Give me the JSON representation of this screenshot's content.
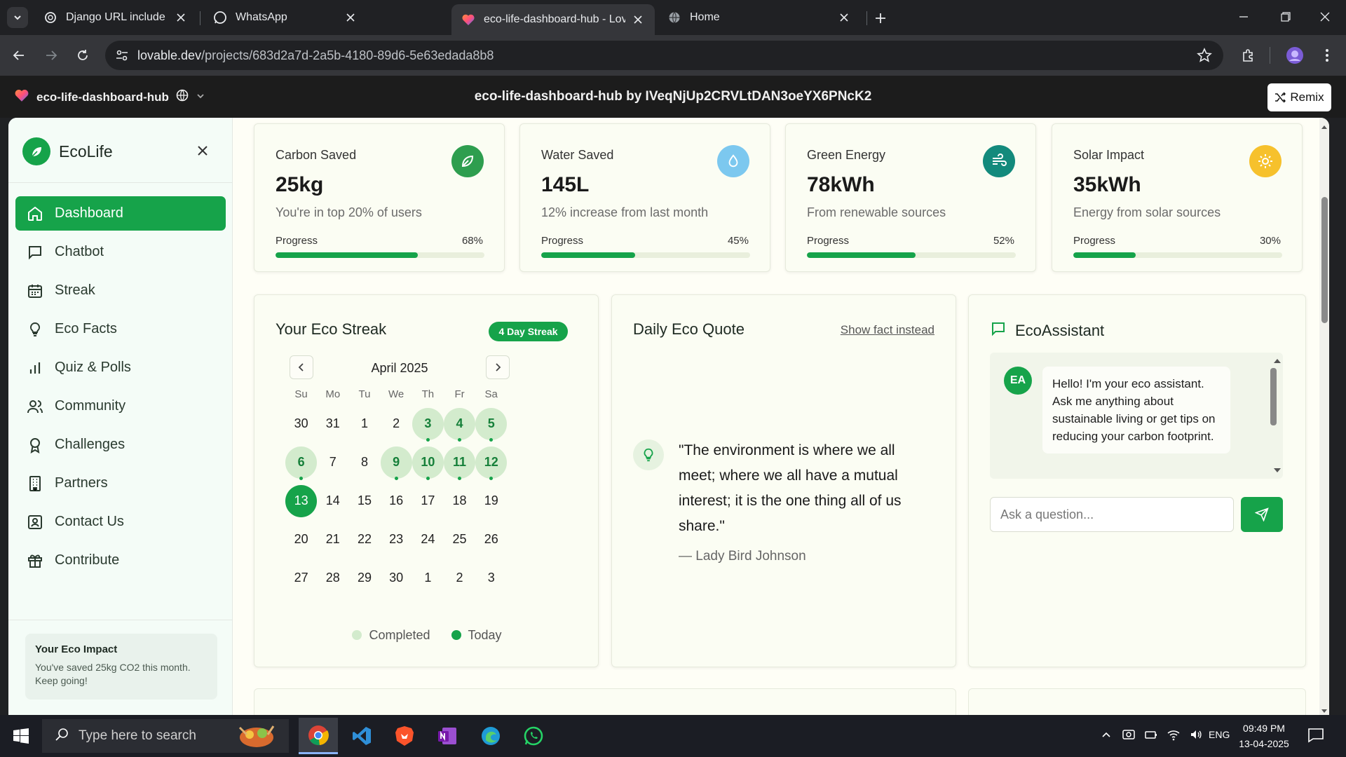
{
  "browser": {
    "tabs": [
      {
        "title": "Django URL include warning",
        "active": false
      },
      {
        "title": "WhatsApp",
        "active": false
      },
      {
        "title": "eco-life-dashboard-hub - Lovab",
        "active": true
      },
      {
        "title": "Home",
        "active": false
      }
    ],
    "url_domain": "lovable.dev",
    "url_path": "/projects/683d2a7d-2a5b-4180-89d6-5e63edada8b8"
  },
  "lovable": {
    "project_name": "eco-life-dashboard-hub",
    "header_title": "eco-life-dashboard-hub by IVeqNjUp2CRVLtDAN3oeYX6PNcK2",
    "remix_label": "Remix"
  },
  "sidebar": {
    "brand": "EcoLife",
    "items": [
      {
        "label": "Dashboard",
        "icon": "home-icon",
        "active": true
      },
      {
        "label": "Chatbot",
        "icon": "chat-icon",
        "active": false
      },
      {
        "label": "Streak",
        "icon": "calendar-icon",
        "active": false
      },
      {
        "label": "Eco Facts",
        "icon": "lightbulb-icon",
        "active": false
      },
      {
        "label": "Quiz & Polls",
        "icon": "bar-chart-icon",
        "active": false
      },
      {
        "label": "Community",
        "icon": "users-icon",
        "active": false
      },
      {
        "label": "Challenges",
        "icon": "award-icon",
        "active": false
      },
      {
        "label": "Partners",
        "icon": "building-icon",
        "active": false
      },
      {
        "label": "Contact Us",
        "icon": "contact-icon",
        "active": false
      },
      {
        "label": "Contribute",
        "icon": "gift-icon",
        "active": false
      }
    ],
    "impact_title": "Your Eco Impact",
    "impact_text": "You've saved 25kg CO2 this month. Keep going!"
  },
  "stats": [
    {
      "label": "Carbon Saved",
      "value": "25kg",
      "sub": "You're in top 20% of users",
      "progress_label": "Progress",
      "percent_text": "68%",
      "percent": 68,
      "icon": "leaf-icon",
      "color": "#2e9e4f"
    },
    {
      "label": "Water Saved",
      "value": "145L",
      "sub": "12% increase from last month",
      "progress_label": "Progress",
      "percent_text": "45%",
      "percent": 45,
      "icon": "droplet-icon",
      "color": "#7cc8ef"
    },
    {
      "label": "Green Energy",
      "value": "78kWh",
      "sub": "From renewable sources",
      "progress_label": "Progress",
      "percent_text": "52%",
      "percent": 52,
      "icon": "wind-icon",
      "color": "#138a7c"
    },
    {
      "label": "Solar Impact",
      "value": "35kWh",
      "sub": "Energy from solar sources",
      "progress_label": "Progress",
      "percent_text": "30%",
      "percent": 30,
      "icon": "sun-icon",
      "color": "#f6c12c"
    }
  ],
  "streak": {
    "title": "Your Eco Streak",
    "badge": "4 Day Streak",
    "month": "April 2025",
    "weekdays": [
      "Su",
      "Mo",
      "Tu",
      "We",
      "Th",
      "Fr",
      "Sa"
    ],
    "weeks": [
      [
        {
          "d": "30",
          "s": ""
        },
        {
          "d": "31",
          "s": ""
        },
        {
          "d": "1",
          "s": ""
        },
        {
          "d": "2",
          "s": ""
        },
        {
          "d": "3",
          "s": "done"
        },
        {
          "d": "4",
          "s": "done"
        },
        {
          "d": "5",
          "s": "done"
        }
      ],
      [
        {
          "d": "6",
          "s": "done"
        },
        {
          "d": "7",
          "s": ""
        },
        {
          "d": "8",
          "s": ""
        },
        {
          "d": "9",
          "s": "done"
        },
        {
          "d": "10",
          "s": "done"
        },
        {
          "d": "11",
          "s": "done"
        },
        {
          "d": "12",
          "s": "done"
        }
      ],
      [
        {
          "d": "13",
          "s": "today"
        },
        {
          "d": "14",
          "s": ""
        },
        {
          "d": "15",
          "s": ""
        },
        {
          "d": "16",
          "s": ""
        },
        {
          "d": "17",
          "s": ""
        },
        {
          "d": "18",
          "s": ""
        },
        {
          "d": "19",
          "s": ""
        }
      ],
      [
        {
          "d": "20",
          "s": ""
        },
        {
          "d": "21",
          "s": ""
        },
        {
          "d": "22",
          "s": ""
        },
        {
          "d": "23",
          "s": ""
        },
        {
          "d": "24",
          "s": ""
        },
        {
          "d": "25",
          "s": ""
        },
        {
          "d": "26",
          "s": ""
        }
      ],
      [
        {
          "d": "27",
          "s": ""
        },
        {
          "d": "28",
          "s": ""
        },
        {
          "d": "29",
          "s": ""
        },
        {
          "d": "30",
          "s": ""
        },
        {
          "d": "1",
          "s": ""
        },
        {
          "d": "2",
          "s": ""
        },
        {
          "d": "3",
          "s": ""
        }
      ]
    ],
    "legend_completed": "Completed",
    "legend_today": "Today"
  },
  "quote": {
    "title": "Daily Eco Quote",
    "toggle": "Show fact instead",
    "text": "\"The environment is where we all meet; where we all have a mutual interest; it is the one thing all of us share.\"",
    "author": "— Lady Bird Johnson"
  },
  "assistant": {
    "title": "EcoAssistant",
    "avatar": "EA",
    "message": "Hello! I'm your eco assistant. Ask me anything about sustainable living or get tips on reducing your carbon footprint.",
    "placeholder": "Ask a question..."
  },
  "taskbar": {
    "search_placeholder": "Type here to search",
    "lang": "ENG",
    "time": "09:49 PM",
    "date": "13-04-2025"
  },
  "colors": {
    "accent": "#16a34a",
    "chrome_dark": "#202124"
  }
}
